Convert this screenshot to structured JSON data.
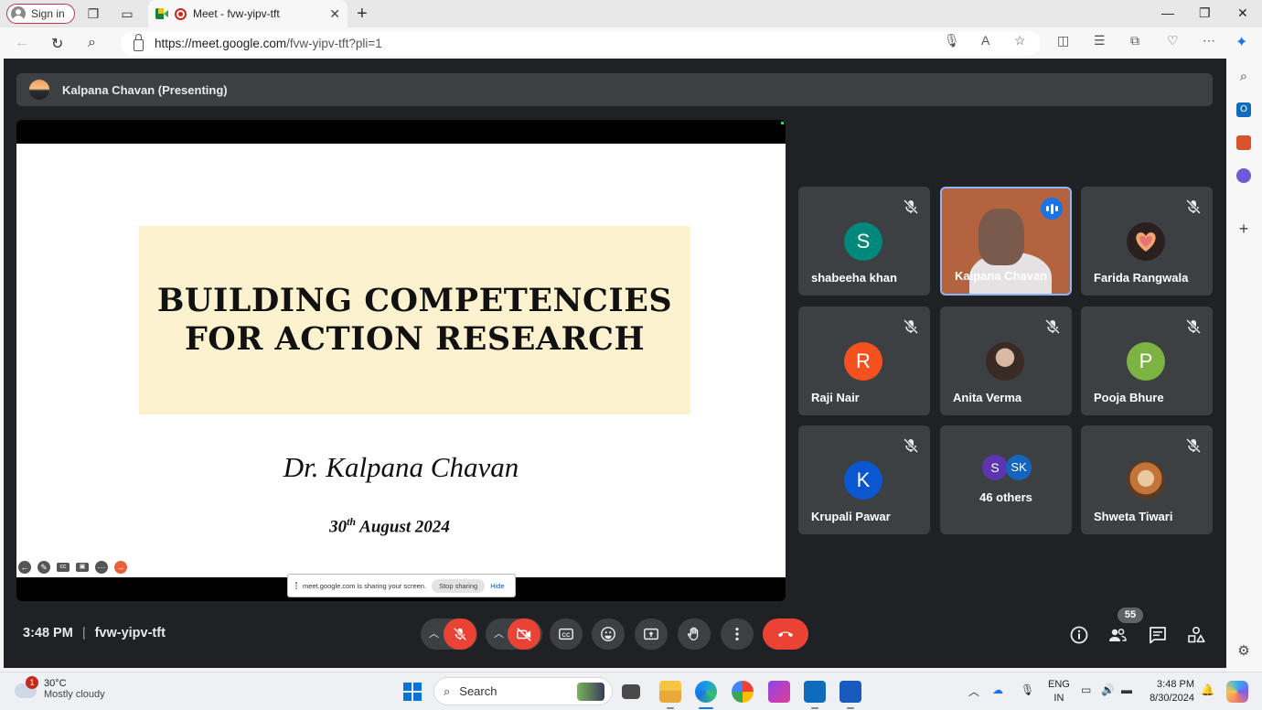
{
  "browser": {
    "signin_label": "Sign in",
    "tab_title": "Meet - fvw-yipv-tft",
    "url_host": "https://meet.google.com",
    "url_path": "/fvw-yipv-tft?pli=1"
  },
  "meet": {
    "presenter_label": "Kalpana Chavan (Presenting)",
    "slide": {
      "title_line1": "BUILDING COMPETENCIES",
      "title_line2": "FOR ACTION RESEARCH",
      "author": "Dr. Kalpana Chavan",
      "date_day": "30",
      "date_suffix": "th",
      "date_rest": " August 2024"
    },
    "share_notice": {
      "text": "meet.google.com is sharing your screen.",
      "stop_label": "Stop sharing",
      "hide_label": "Hide"
    },
    "participants": [
      {
        "name": "shabeeha khan",
        "initial": "S",
        "color": "#00897b",
        "muted": true
      },
      {
        "name": "Kalpana Chavan",
        "initial": "",
        "color": "#b3643e",
        "muted": false,
        "speaking": true
      },
      {
        "name": "Farida Rangwala",
        "initial": "",
        "color": "#e5737a",
        "muted": true
      },
      {
        "name": "Raji Nair",
        "initial": "R",
        "color": "#f4511e",
        "muted": true
      },
      {
        "name": "Anita Verma",
        "initial": "",
        "color": "#6d5a52",
        "muted": true
      },
      {
        "name": "Pooja Bhure",
        "initial": "P",
        "color": "#7cb342",
        "muted": true
      },
      {
        "name": "Krupali Pawar",
        "initial": "K",
        "color": "#0b57d0",
        "muted": true
      },
      {
        "name": "46 others",
        "initial": "",
        "color": "#3c4043",
        "muted": false
      },
      {
        "name": "Shweta Tiwari",
        "initial": "",
        "color": "#b38a4a",
        "muted": true
      }
    ],
    "others_avatars": [
      {
        "initial": "S",
        "color": "#5e35b1"
      },
      {
        "initial": "SK",
        "color": "#1565c0"
      }
    ],
    "time": "3:48 PM",
    "meeting_code": "fvw-yipv-tft",
    "participant_count": "55"
  },
  "taskbar": {
    "weather_badge": "1",
    "temperature": "30°C",
    "weather": "Mostly cloudy",
    "search_label": "Search",
    "lang_line1": "ENG",
    "lang_line2": "IN",
    "clock_time": "3:48 PM",
    "clock_date": "8/30/2024"
  }
}
